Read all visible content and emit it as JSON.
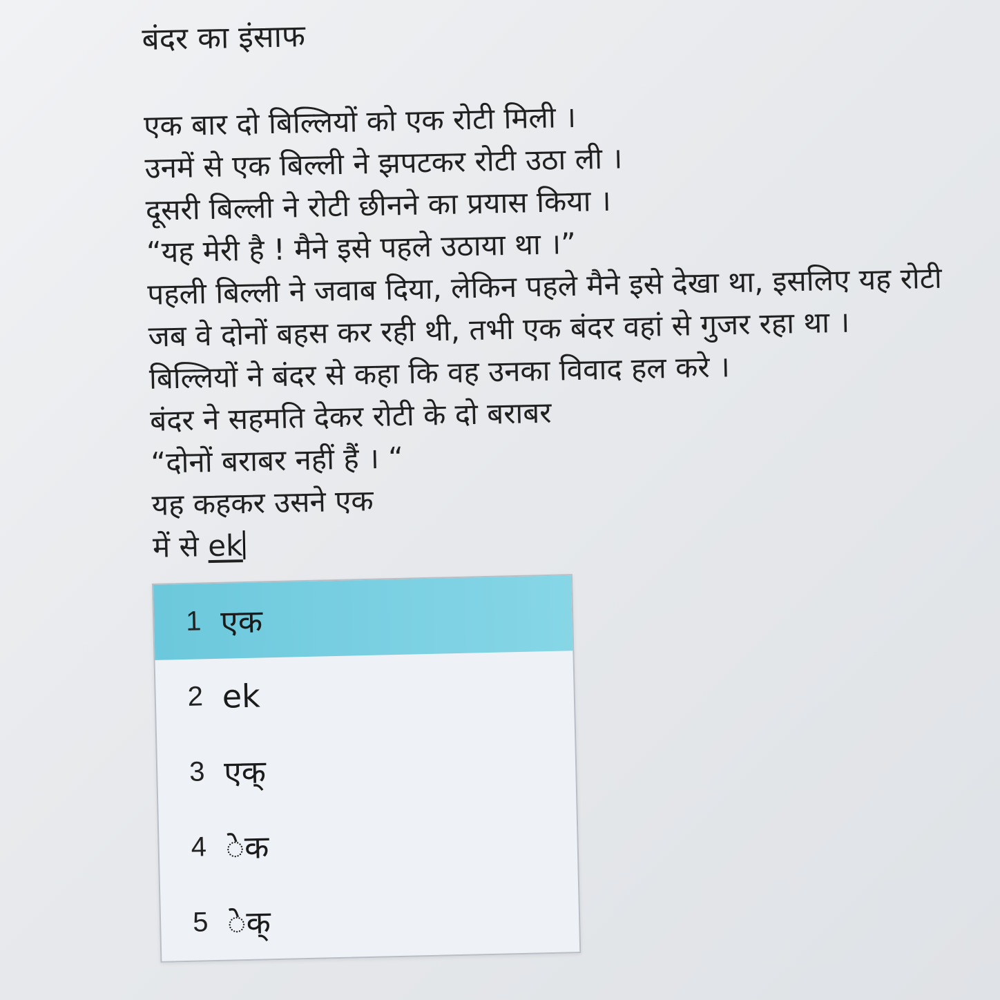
{
  "document": {
    "title": "बंदर का इंसाफ",
    "lines": [
      "एक बार दो बिल्लियों को एक रोटी मिली ।",
      "उनमें से एक बिल्ली ने झपटकर रोटी उठा ली ।",
      "दूसरी बिल्ली ने रोटी छीनने का प्रयास किया ।",
      "“यह मेरी है ! मैने इसे पहले उठाया था ।”",
      "पहली बिल्ली ने जवाब दिया, लेकिन पहले मैने इसे देखा था, इसलिए यह रोटी",
      "जब वे दोनों बहस कर रही थी, तभी एक बंदर वहां से गुजर रहा था ।",
      "बिल्लियों ने बंदर से कहा कि वह उनका विवाद हल करे ।",
      "बंदर ने सहमति देकर रोटी के दो बराबर",
      "“दोनों बराबर नहीं हैं । “",
      "यह कहकर उसने एक"
    ],
    "current_line_prefix": "में से ",
    "current_input": "ek"
  },
  "ime_candidates": [
    {
      "number": "1",
      "text": "एक",
      "selected": true
    },
    {
      "number": "2",
      "text": "ek",
      "selected": false
    },
    {
      "number": "3",
      "text": "एक्",
      "selected": false
    },
    {
      "number": "4",
      "text": "ेक",
      "selected": false
    },
    {
      "number": "5",
      "text": "ेक्",
      "selected": false
    }
  ]
}
